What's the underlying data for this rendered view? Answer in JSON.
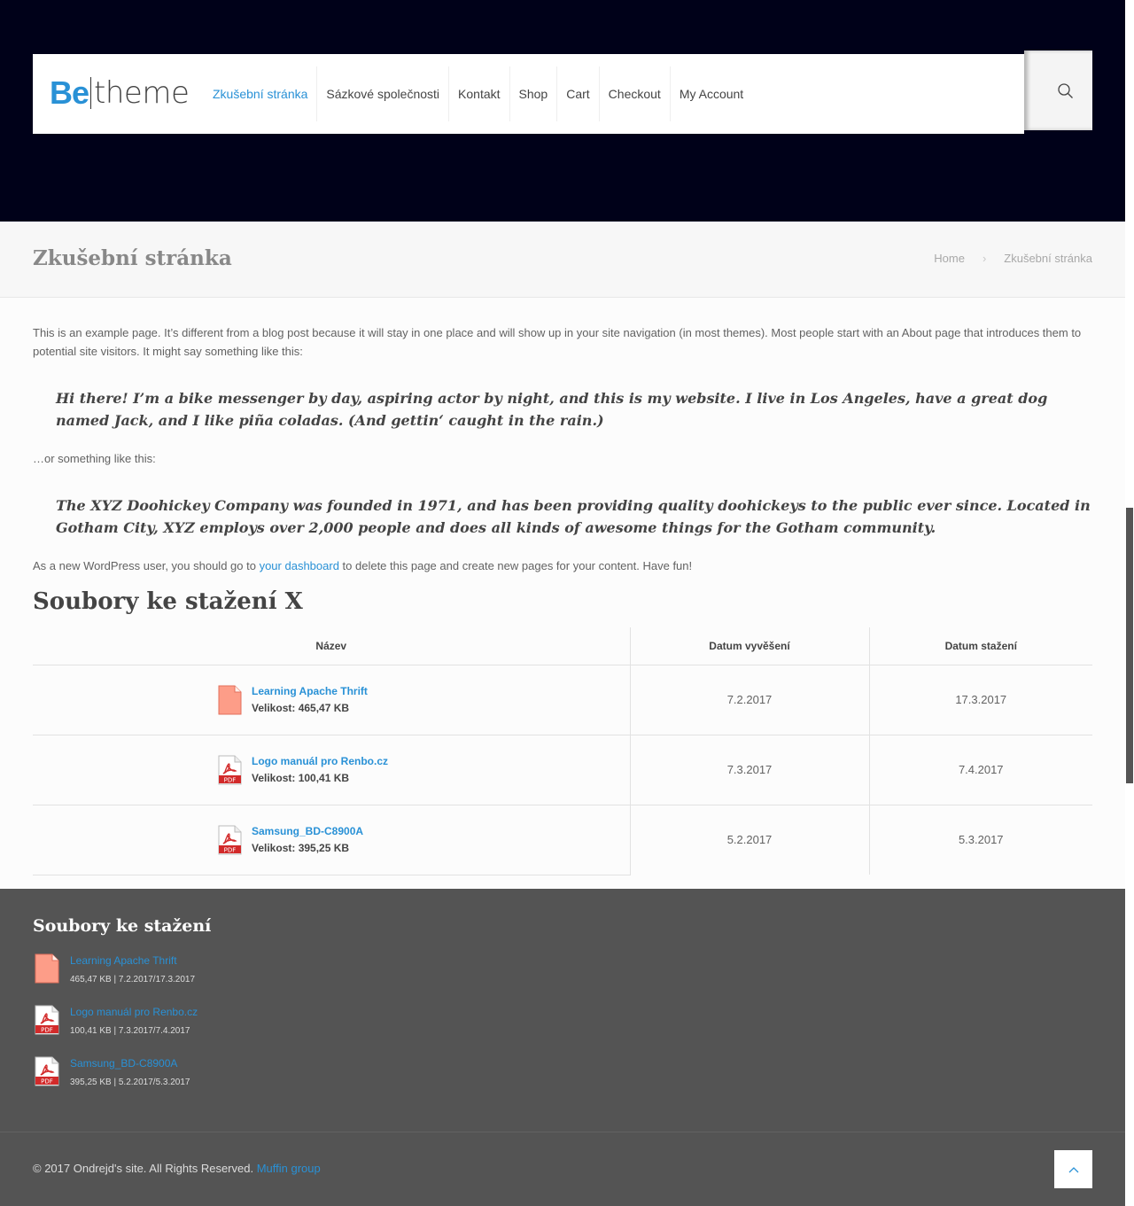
{
  "logo": {
    "be": "Be",
    "theme": "theme"
  },
  "menu": [
    {
      "label": "Zkušební stránka",
      "active": true
    },
    {
      "label": "Sázkové společnosti"
    },
    {
      "label": "Kontakt"
    },
    {
      "label": "Shop"
    },
    {
      "label": "Cart"
    },
    {
      "label": "Checkout"
    },
    {
      "label": "My Account"
    }
  ],
  "search_icon": "search-icon",
  "subheader": {
    "title": "Zkušební stránka",
    "breadcrumbs": [
      "Home",
      "Zkušební stránka"
    ]
  },
  "content": {
    "intro": "This is an example page. It’s different from a blog post because it will stay in one place and will show up in your site navigation (in most themes). Most people start with an About page that introduces them to potential site visitors. It might say something like this:",
    "quote1": "Hi there! I’m a bike messenger by day, aspiring actor by night, and this is my website. I live in Los Angeles, have a great dog named Jack, and I like piña coladas. (And gettin‘ caught in the rain.)",
    "or_line": "…or something like this:",
    "quote2": "The XYZ Doohickey Company was founded in 1971, and has been providing quality doohickeys to the public ever since. Located in Gotham City, XYZ employs over 2,000 people and does all kinds of awesome things for the Gotham community.",
    "newuser_pre": "As a new WordPress user, you should go to ",
    "newuser_link": "your dashboard",
    "newuser_post": " to delete this page and create new pages for your content. Have fun!",
    "downloads_title": "Soubory ke stažení X"
  },
  "table": {
    "headers": [
      "Název",
      "Datum vyvěšení",
      "Datum stažení"
    ],
    "rows": [
      {
        "icon": "file-icon",
        "name": "Learning Apache Thrift",
        "size": "Velikost: 465,47 KB",
        "posted": "7.2.2017",
        "downloaded": "17.3.2017"
      },
      {
        "icon": "pdf-icon",
        "name": "Logo manuál pro Renbo.cz",
        "size": "Velikost: 100,41 KB",
        "posted": "7.3.2017",
        "downloaded": "7.4.2017"
      },
      {
        "icon": "pdf-icon",
        "name": "Samsung_BD-C8900A",
        "size": "Velikost: 395,25 KB",
        "posted": "5.2.2017",
        "downloaded": "5.3.2017"
      }
    ]
  },
  "footer_widget": {
    "title": "Soubory ke stažení",
    "items": [
      {
        "icon": "file-icon",
        "name": "Learning Apache Thrift",
        "meta": "465,47 KB | 7.2.2017/17.3.2017"
      },
      {
        "icon": "pdf-icon",
        "name": "Logo manuál pro Renbo.cz",
        "meta": "100,41 KB | 7.3.2017/7.4.2017"
      },
      {
        "icon": "pdf-icon",
        "name": "Samsung_BD-C8900A",
        "meta": "395,25 KB | 5.2.2017/5.3.2017"
      }
    ]
  },
  "footer": {
    "copyright": "© 2017 Ondrejd's site. All Rights Reserved. ",
    "credit_link": "Muffin group"
  },
  "colors": {
    "accent": "#2991d6",
    "header_bg": "#000119",
    "footer_bg": "#545454"
  }
}
